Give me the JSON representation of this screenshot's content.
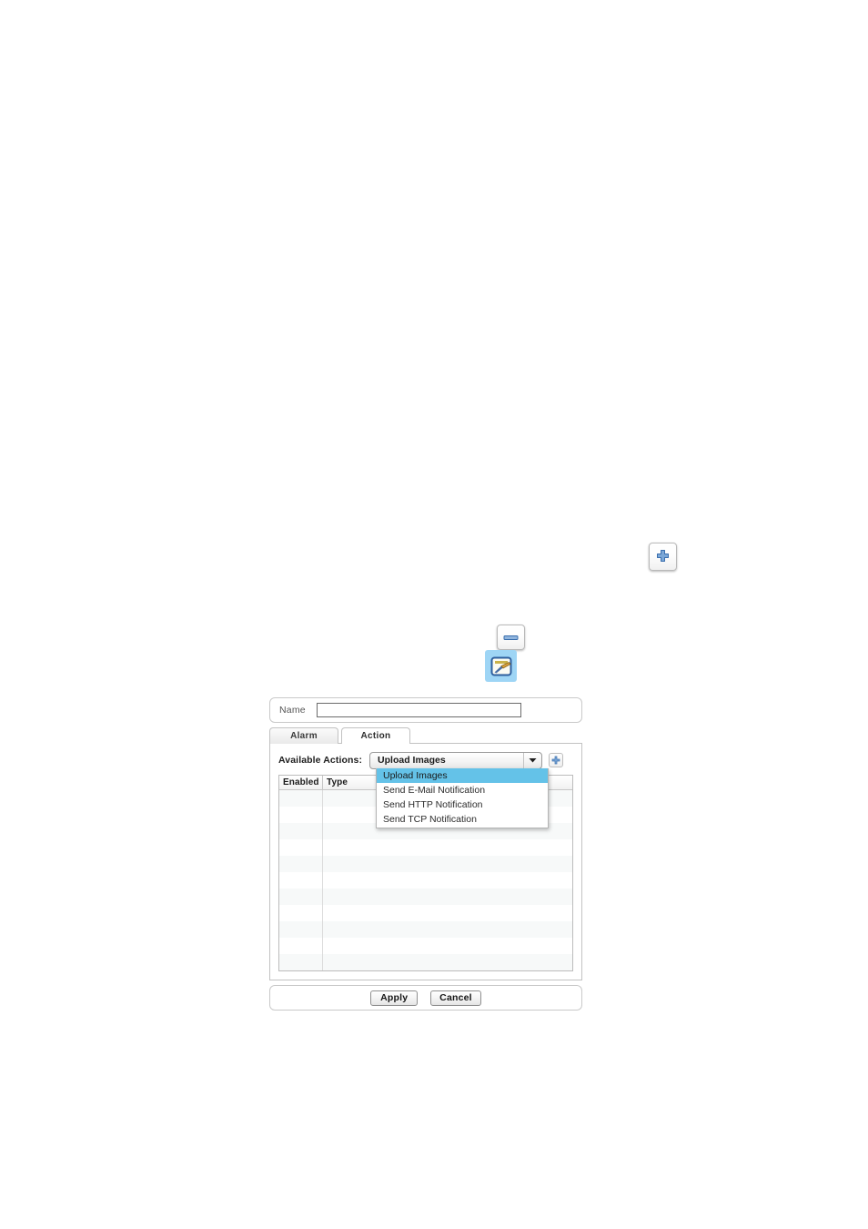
{
  "toolbar_icons": {
    "add_label": "add-icon",
    "remove_label": "remove-icon",
    "edit_label": "edit-icon"
  },
  "dialog": {
    "name_field": {
      "label": "Name",
      "value": "",
      "placeholder": ""
    },
    "tabs": [
      {
        "label": "Alarm",
        "active": false
      },
      {
        "label": "Action",
        "active": true
      }
    ],
    "available_actions": {
      "label": "Available Actions:",
      "selected": "Upload Images",
      "options": [
        "Upload Images",
        "Send E-Mail Notification",
        "Send HTTP Notification",
        "Send TCP Notification"
      ],
      "dropdown_open": true,
      "highlight_color": "#64c2e8",
      "add_button_label": "add-action-icon"
    },
    "table": {
      "columns": [
        "Enabled",
        "Type"
      ],
      "rows": [],
      "empty_row_count": 11
    },
    "footer": {
      "apply_label": "Apply",
      "cancel_label": "Cancel"
    }
  }
}
